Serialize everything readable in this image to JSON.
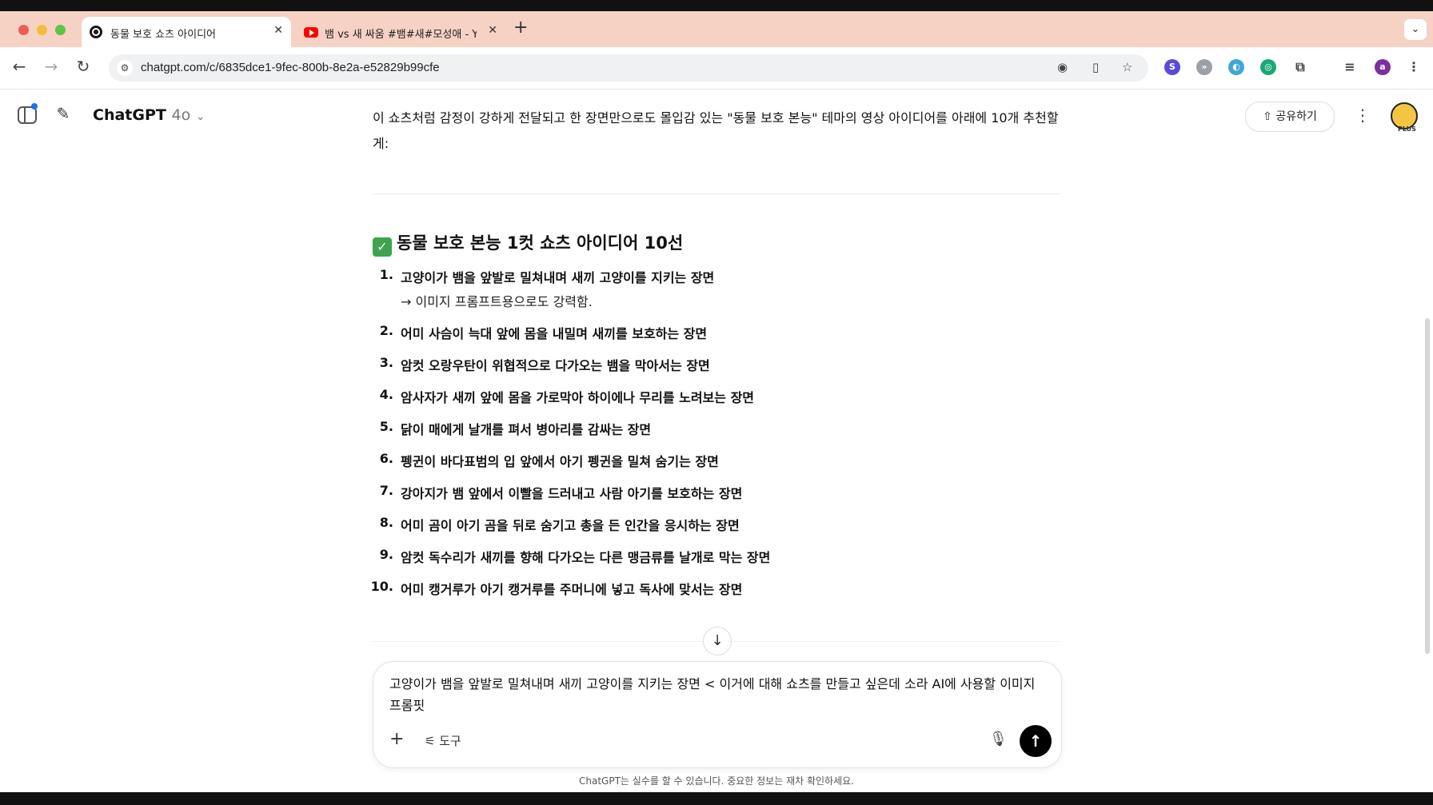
{
  "browser": {
    "tabs": [
      {
        "title": "동물 보호 쇼츠 아이디어",
        "active": true,
        "favicon": "chatgpt-icon"
      },
      {
        "title": "뱀 vs 새 싸움 #뱀#새#모성애 - Yo",
        "active": false,
        "favicon": "youtube-icon"
      }
    ],
    "url": "chatgpt.com/c/6835dce1-9fec-800b-8e2a-e52829b99cfe"
  },
  "header": {
    "model_name": "ChatGPT",
    "model_version": "4o",
    "share_label": "공유하기",
    "plan_badge": "PLUS"
  },
  "message": {
    "intro": "이 쇼츠처럼 감정이 강하게 전달되고 한 장면만으로도 몰입감 있는 \"동물 보호 본능\" 테마의 영상 아이디어를 아래에 10개 추천할게:",
    "section_title": "동물 보호 본능 1컷 쇼츠 아이디어 10선",
    "items": [
      {
        "num": "1.",
        "text": "고양이가 뱀을 앞발로 밀쳐내며 새끼 고양이를 지키는 장면",
        "sub": "→ 이미지 프롬프트용으로도 강력함."
      },
      {
        "num": "2.",
        "text": "어미 사슴이 늑대 앞에 몸을 내밀며 새끼를 보호하는 장면"
      },
      {
        "num": "3.",
        "text": "암컷 오랑우탄이 위협적으로 다가오는 뱀을 막아서는 장면"
      },
      {
        "num": "4.",
        "text": "암사자가 새끼 앞에 몸을 가로막아 하이에나 무리를 노려보는 장면"
      },
      {
        "num": "5.",
        "text": "닭이 매에게 날개를 펴서 병아리를 감싸는 장면"
      },
      {
        "num": "6.",
        "text": "펭귄이 바다표범의 입 앞에서 아기 펭귄을 밀쳐 숨기는 장면"
      },
      {
        "num": "7.",
        "text": "강아지가 뱀 앞에서 이빨을 드러내고 사람 아기를 보호하는 장면"
      },
      {
        "num": "8.",
        "text": "어미 곰이 아기 곰을 뒤로 숨기고 총을 든 인간을 응시하는 장면"
      },
      {
        "num": "9.",
        "text": "암컷 독수리가 새끼를 향해 다가오는 다른 맹금류를 날개로 막는 장면"
      },
      {
        "num": "10.",
        "text": "어미 캥거루가 아기 캥거루를 주머니에 넣고 독사에 맞서는 장면"
      }
    ]
  },
  "composer": {
    "text": "고양이가 뱀을 앞발로 밀쳐내며 새끼 고양이를 지키는 장면 < 이거에 대해 쇼츠를 만들고 싶은데 소라 AI에 사용할 이미지 프롬핏",
    "tools_label": "도구"
  },
  "footer": {
    "disclaimer": "ChatGPT는 실수를 할 수 있습니다. 중요한 정보는 재차 확인하세요."
  }
}
